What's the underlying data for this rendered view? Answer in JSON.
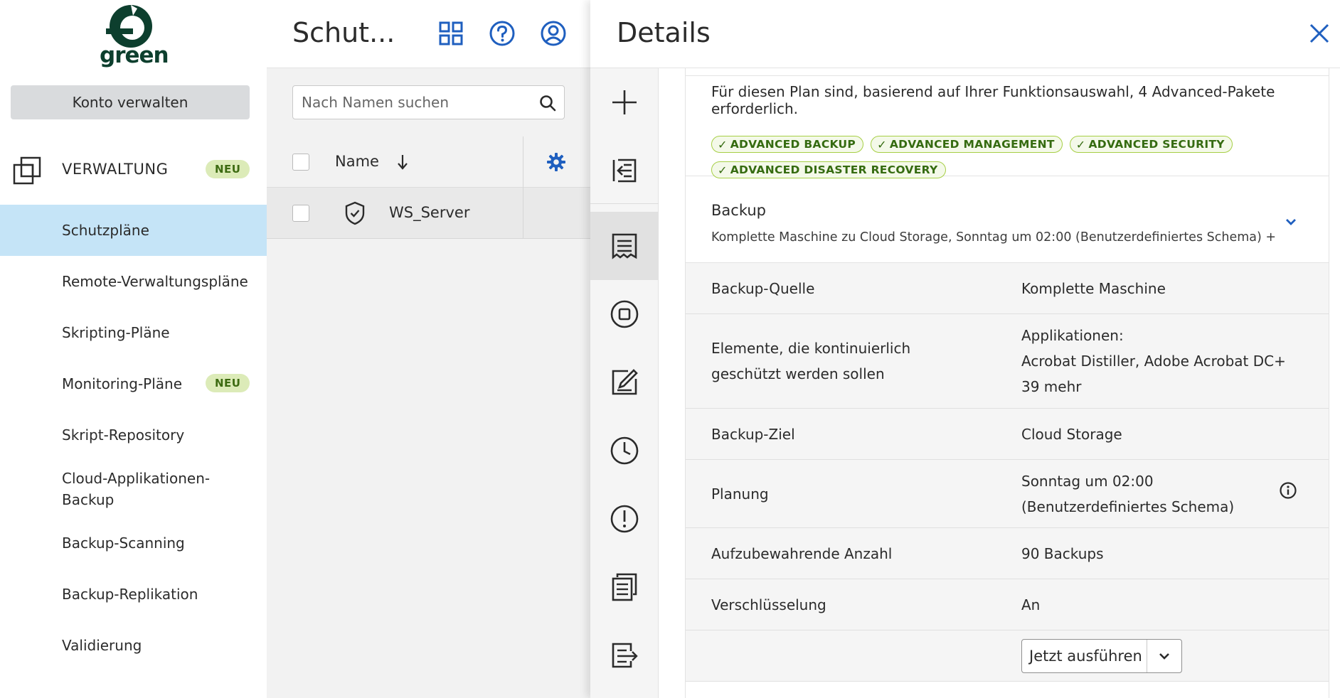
{
  "brand": {
    "logo_text": "green",
    "accent": "#1f5fbf",
    "brand_green": "#0d3f2e"
  },
  "sidebar": {
    "manage_button": "Konto verwalten",
    "section": {
      "title": "VERWALTUNG",
      "badge": "NEU",
      "icon": "pages-stack-icon"
    },
    "items": [
      {
        "label": "Schutzpläne",
        "active": true
      },
      {
        "label": "Remote-Verwaltungspläne"
      },
      {
        "label": "Skripting-Pläne"
      },
      {
        "label": "Monitoring-Pläne",
        "badge": "NEU"
      },
      {
        "label": "Skript-Repository"
      },
      {
        "label": "Cloud-Applikationen-Backup"
      },
      {
        "label": "Backup-Scanning"
      },
      {
        "label": "Backup-Replikation"
      },
      {
        "label": "Validierung"
      }
    ]
  },
  "middle": {
    "title": "Schut...",
    "header_icons": [
      "grid-icon",
      "help-icon",
      "account-icon"
    ],
    "search": {
      "placeholder": "Nach Namen suchen",
      "value": ""
    },
    "table": {
      "column_name": "Name",
      "rows": [
        {
          "name": "WS_Server",
          "icon": "shield-check-icon"
        }
      ]
    }
  },
  "details": {
    "title": "Details",
    "rail_icons": [
      "plus-icon",
      "import-icon",
      "details-icon",
      "stop-icon",
      "edit-icon",
      "clock-icon",
      "alert-icon",
      "copy-icon",
      "export-icon"
    ],
    "notice": "Für diesen Plan sind, basierend auf Ihrer Funktionsauswahl, 4 Advanced-Pakete erforderlich.",
    "tags": [
      "ADVANCED BACKUP",
      "ADVANCED MANAGEMENT",
      "ADVANCED SECURITY",
      "ADVANCED DISASTER RECOVERY"
    ],
    "backup": {
      "title": "Backup",
      "summary": "Komplette Maschine zu Cloud Storage, Sonntag um 02:00 (Benutzerdefiniertes Schema) + ..."
    },
    "properties": [
      {
        "label": "Backup-Quelle",
        "value": "Komplette Maschine"
      },
      {
        "label": "Elemente, die kontinuierlich geschützt werden sollen",
        "value_line1": "Applikationen:",
        "value_line2": "Acrobat Distiller, Adobe Acrobat DC+ 39 mehr"
      },
      {
        "label": "Backup-Ziel",
        "value": "Cloud Storage"
      },
      {
        "label": "Planung",
        "value": "Sonntag um 02:00 (Benutzerdefiniertes Schema)"
      },
      {
        "label": "Aufzubewahrende Anzahl",
        "value": "90 Backups"
      },
      {
        "label": "Verschlüsselung",
        "value": "An"
      }
    ],
    "run_button": "Jetzt ausführen"
  }
}
